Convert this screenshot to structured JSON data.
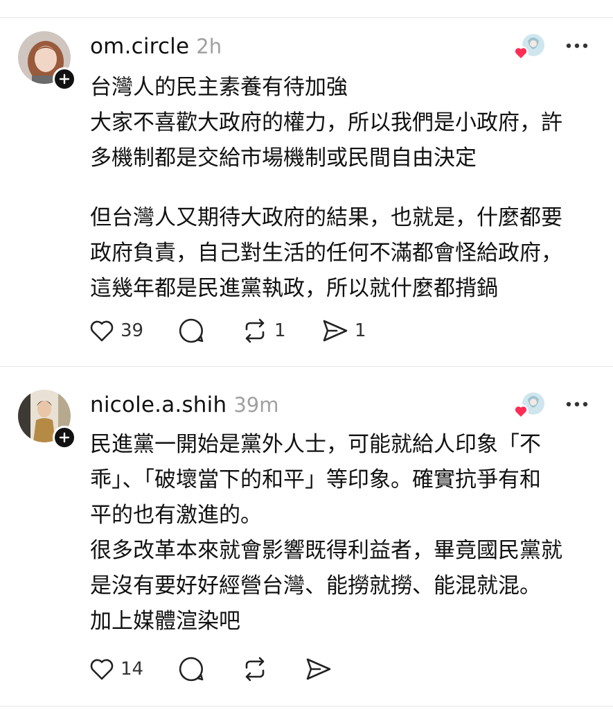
{
  "posts": [
    {
      "username": "om.circle",
      "time": "2h",
      "paragraphs": [
        "台灣人的民主素養有待加強",
        "大家不喜歡大政府的權力，所以我們是小政府，許",
        "多機制都是交給市場機制或民間自由決定",
        "",
        "但台灣人又期待大政府的結果，也就是，什麼都要",
        "政府負責，自己對生活的任何不滿都會怪給政府，",
        "這幾年都是民進黨執政，所以就什麼都揹鍋"
      ],
      "likes": "39",
      "reposts": "1",
      "shares": "1"
    },
    {
      "username": "nicole.a.shih",
      "time": "39m",
      "paragraphs": [
        "民進黨一開始是黨外人士，可能就給人印象「不",
        "乖」、「破壞當下的和平」等印象。確實抗爭有和",
        "平的也有激進的。",
        "很多改革本來就會影響既得利益者，畢竟國民黨就",
        "是沒有要好好經營台灣、能撈就撈、能混就混。",
        "加上媒體渲染吧"
      ],
      "likes": "14"
    }
  ],
  "colors": {
    "heart": "#ff2d55",
    "muted": "#a0a0a0",
    "text": "#111111",
    "divider": "#e6e6e6"
  },
  "icons": [
    "heart-icon",
    "comment-icon",
    "repost-icon",
    "share-icon",
    "more-icon",
    "plus-icon"
  ]
}
